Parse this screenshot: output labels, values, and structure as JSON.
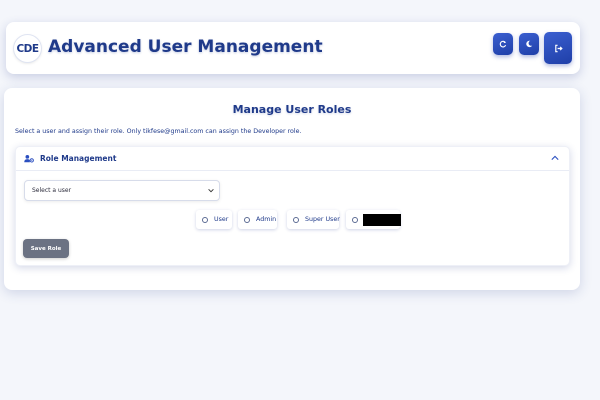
{
  "header": {
    "logo_text": "CDE",
    "title": "Advanced User Management",
    "buttons": {
      "refresh_icon": "refresh-icon",
      "theme_icon": "moon-icon",
      "logout_icon": "logout-icon"
    }
  },
  "panel": {
    "title": "Manage User Roles",
    "instruction": "Select a user and assign their role. Only tikfese@gmail.com can assign the Developer role."
  },
  "card": {
    "title": "Role Management",
    "header_icon": "user-gear-icon",
    "collapse_icon": "chevron-up-icon"
  },
  "user_select": {
    "value": "Select a user"
  },
  "roles": [
    {
      "label": "User",
      "selected": false
    },
    {
      "label": "Admin",
      "selected": false
    },
    {
      "label": "Super User",
      "selected": false
    },
    {
      "label": "",
      "selected": false,
      "redacted": true
    }
  ],
  "save_button": {
    "label": "Save Role"
  },
  "colors": {
    "accent": "#1f3a8a",
    "button_blue": "#2b4fc0",
    "save_gray": "#6b7283",
    "background": "#f4f6fb"
  }
}
